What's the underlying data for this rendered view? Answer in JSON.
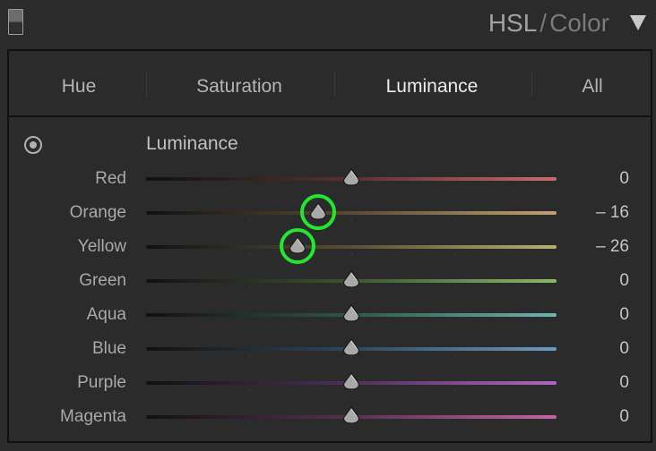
{
  "header": {
    "title_primary": "HSL",
    "title_separator": "/",
    "title_secondary": "Color"
  },
  "tabs": [
    {
      "label": "Hue",
      "active": false
    },
    {
      "label": "Saturation",
      "active": false
    },
    {
      "label": "Luminance",
      "active": true
    },
    {
      "label": "All",
      "active": false
    }
  ],
  "section": {
    "title": "Luminance"
  },
  "slider_range": [
    -100,
    100
  ],
  "sliders": [
    {
      "name": "red",
      "label": "Red",
      "value": 0,
      "value_text": "0",
      "colors": [
        "#111111",
        "#5a3030",
        "#c96b6b"
      ],
      "highlighted": false
    },
    {
      "name": "orange",
      "label": "Orange",
      "value": -16,
      "value_text": "– 16",
      "colors": [
        "#111111",
        "#5a4a33",
        "#c2a16f"
      ],
      "highlighted": true
    },
    {
      "name": "yellow",
      "label": "Yellow",
      "value": -26,
      "value_text": "– 26",
      "colors": [
        "#111111",
        "#555233",
        "#b7b070"
      ],
      "highlighted": true
    },
    {
      "name": "green",
      "label": "Green",
      "value": 0,
      "value_text": "0",
      "colors": [
        "#111111",
        "#3d5532",
        "#8cb86a"
      ],
      "highlighted": false
    },
    {
      "name": "aqua",
      "label": "Aqua",
      "value": 0,
      "value_text": "0",
      "colors": [
        "#111111",
        "#305550",
        "#6cb7ad"
      ],
      "highlighted": false
    },
    {
      "name": "blue",
      "label": "Blue",
      "value": 0,
      "value_text": "0",
      "colors": [
        "#111111",
        "#30475a",
        "#6b9bbf"
      ],
      "highlighted": false
    },
    {
      "name": "purple",
      "label": "Purple",
      "value": 0,
      "value_text": "0",
      "colors": [
        "#111111",
        "#4f305a",
        "#ae68c2"
      ],
      "highlighted": false
    },
    {
      "name": "magenta",
      "label": "Magenta",
      "value": 0,
      "value_text": "0",
      "colors": [
        "#111111",
        "#5a3050",
        "#c265a6"
      ],
      "highlighted": false
    }
  ],
  "highlight_color": "#22e62f"
}
